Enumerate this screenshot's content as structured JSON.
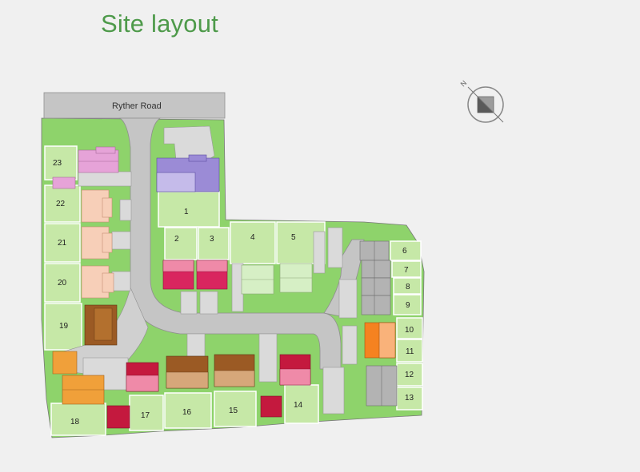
{
  "page_title": "Site layout",
  "road_name": "Ryther Road",
  "compass_label": "N",
  "plot_labels": {
    "p1": "1",
    "p2": "2",
    "p3": "3",
    "p4": "4",
    "p5": "5",
    "p6": "6",
    "p7": "7",
    "p8": "8",
    "p9": "9",
    "p10": "10",
    "p11": "11",
    "p12": "12",
    "p13": "13",
    "p14": "14",
    "p15": "15",
    "p16": "16",
    "p17": "17",
    "p18": "18",
    "p19": "19",
    "p20": "20",
    "p21": "21",
    "p22": "22",
    "p23": "23"
  },
  "colors": {
    "background": "#f0f0f0",
    "grass": "#8ed36b",
    "plot": "#c6e8a7",
    "road": "#c5c5c5",
    "path": "#dadada",
    "title": "#4e9a4a",
    "house_pink": "#e6a3d8",
    "house_peach": "#f7cfb8",
    "house_purple": "#9b8bd6",
    "house_magenta": "#d9265f",
    "house_lightgreen": "#d6efc5",
    "house_brown": "#9b5a24",
    "house_orange": "#f0a03a",
    "house_grey": "#b3b3b3",
    "house_crimson": "#c4193e",
    "house_orange_bright": "#f58220"
  }
}
